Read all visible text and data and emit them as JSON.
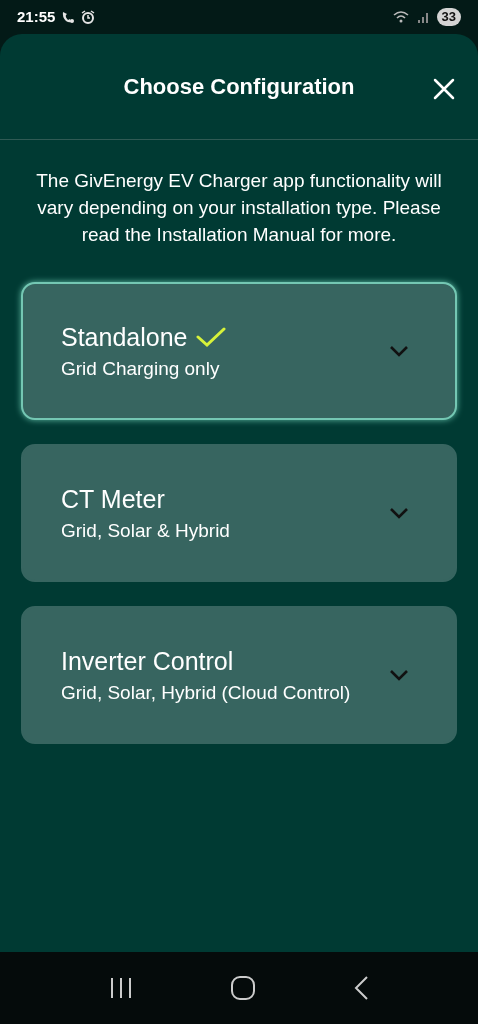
{
  "status_bar": {
    "time": "21:55",
    "battery": "33"
  },
  "header": {
    "title": "Choose Configuration"
  },
  "intro": "The GivEnergy EV Charger app functionality will vary depending on your installation type. Please read the Installation Manual for more.",
  "options": [
    {
      "title": "Standalone",
      "subtitle": "Grid Charging only",
      "selected": true
    },
    {
      "title": "CT Meter",
      "subtitle": "Grid, Solar & Hybrid",
      "selected": false
    },
    {
      "title": "Inverter Control",
      "subtitle": "Grid, Solar, Hybrid (Cloud Control)",
      "selected": false
    }
  ]
}
